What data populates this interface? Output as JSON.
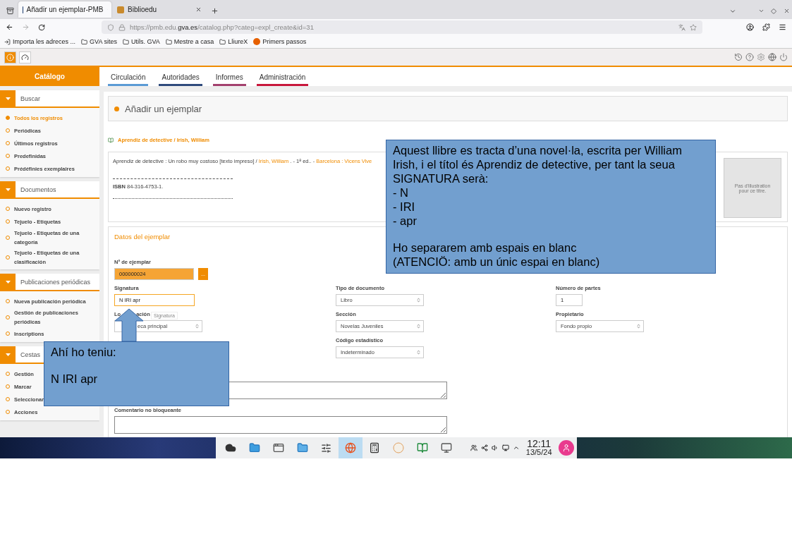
{
  "browser": {
    "tabs": [
      {
        "title": "Añadir un ejemplar-PMB",
        "selected": true
      },
      {
        "title": "Biblioedu",
        "selected": false
      }
    ],
    "url": {
      "prefix": "https://pmb.edu.",
      "domain": "gva.es",
      "path": "/catalog.php?categ=expl_create&id=31"
    },
    "bookmarks": [
      {
        "kind": "import",
        "label": "Importa les adreces ..."
      },
      {
        "kind": "folder",
        "label": "GVA sites"
      },
      {
        "kind": "folder",
        "label": "Utils. GVA"
      },
      {
        "kind": "folder",
        "label": "Mestre a casa"
      },
      {
        "kind": "folder",
        "label": "LliureX"
      },
      {
        "kind": "firefox",
        "label": "Primers passos"
      }
    ]
  },
  "app": {
    "module": "Catálogo",
    "menu": [
      {
        "label": "Circulación",
        "color": "#5b9bd5"
      },
      {
        "label": "Autoridades",
        "color": "#2f4b7c"
      },
      {
        "label": "Informes",
        "color": "#a3416e"
      },
      {
        "label": "Administración",
        "color": "#c8173c"
      }
    ],
    "sidebar": [
      {
        "title": "Buscar",
        "items": [
          {
            "label": "Todos los registros",
            "selected": true
          },
          {
            "label": "Periódicas",
            "selected": false
          },
          {
            "label": "Últimos registros",
            "selected": false
          },
          {
            "label": "Predefinidas",
            "selected": false
          },
          {
            "label": "Prédéfinies exemplaires",
            "selected": false
          }
        ]
      },
      {
        "title": "Documentos",
        "items": [
          {
            "label": "Nuevo registro",
            "selected": false
          },
          {
            "label": "Tejuelo - Etiquetas",
            "selected": false
          },
          {
            "label": "Tejuelo - Etiquetas de una categoría",
            "selected": false
          },
          {
            "label": "Tejuelo - Etiquetas de una clasificación",
            "selected": false
          }
        ]
      },
      {
        "title": "Publicaciones periódicas",
        "items": [
          {
            "label": "Nueva publicación periódica",
            "selected": false
          },
          {
            "label": "Gestión de publicaciones periódicas",
            "selected": false
          },
          {
            "label": "Inscriptions",
            "selected": false
          }
        ]
      },
      {
        "title": "Cestas",
        "items": [
          {
            "label": "Gestión",
            "selected": false
          },
          {
            "label": "Marcar",
            "selected": false
          },
          {
            "label": "Seleccionar",
            "selected": false
          },
          {
            "label": "Acciones",
            "selected": false
          }
        ]
      }
    ],
    "page_title": "Añadir un ejemplar",
    "record": {
      "heading": "Aprendiz de detective / Irish, William",
      "description": [
        {
          "kind": "text",
          "text": "Aprendiz de detective : Un robo muy costoso [texto impreso] / "
        },
        {
          "kind": "link",
          "text": "Irish, William"
        },
        {
          "kind": "text",
          "text": " . - 1ª ed.. - "
        },
        {
          "kind": "link",
          "text": "Barcelona : Vicens Vive"
        }
      ],
      "isbn_label": "ISBN",
      "isbn": "84-316-4753-1.",
      "image_text": "Pas d'illustration\npour ce titre."
    },
    "form": {
      "title": "Datos del ejemplar",
      "rows": [
        [
          {
            "kind": "code",
            "label": "Nº de ejemplar",
            "value": "000000024",
            "button": "..."
          },
          {
            "kind": "empty"
          },
          {
            "kind": "empty"
          }
        ],
        [
          {
            "kind": "input",
            "label": "Signatura",
            "value": "N IRI apr",
            "focused": true,
            "tooltip": "Signatura"
          },
          {
            "kind": "select",
            "label": "Tipo de documento",
            "value": "Libro"
          },
          {
            "kind": "number",
            "label": "Número de partes",
            "value": "1"
          }
        ],
        [
          {
            "kind": "select",
            "label": "Lo",
            "label_tail": "ación",
            "value": "eca principal",
            "covered": true
          },
          {
            "kind": "select",
            "label": "Sección",
            "value": "Novelas Juveniles"
          },
          {
            "kind": "select",
            "label": "Propietario",
            "value": "Fondo propio"
          }
        ],
        [
          {
            "kind": "empty"
          },
          {
            "kind": "select",
            "label": "Código estadístico",
            "value": "Indeterminado"
          },
          {
            "kind": "empty"
          }
        ],
        [
          {
            "kind": "textarea"
          }
        ],
        [
          {
            "kind": "textarea",
            "label": "Comentario no bloqueante"
          }
        ]
      ]
    }
  },
  "notes": [
    {
      "kind": "box",
      "paragraphs": [
        "Aquest llibre es tracta d’una novel·la, escrita per William Irish, i el títol és Aprendiz de detective, per tant la seua SIGNATURA serà:\n- N\n- IRI\n- apr",
        "Ho separarem amb espais en blanc\n(ATENCIÖ: amb un únic espai en blanc)"
      ]
    },
    {
      "kind": "box",
      "paragraphs": [
        "Ahí ho teniu:",
        "N IRI apr"
      ]
    },
    {
      "kind": "arrow"
    }
  ],
  "taskbar": {
    "time": "12:11",
    "date": "13/5/24"
  }
}
